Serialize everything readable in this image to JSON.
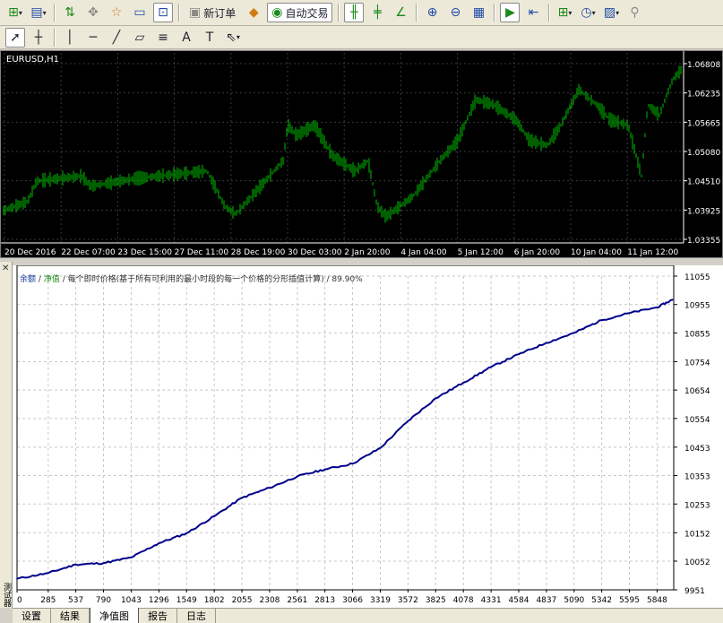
{
  "toolbar_main": {
    "new_order_label": "新订单",
    "auto_trade_label": "自动交易",
    "icons": [
      "new-chart-icon",
      "profiles-icon",
      "market-watch-icon",
      "navigator-icon",
      "data-window-icon",
      "terminal-icon",
      "tester-icon",
      "new-order-icon",
      "metaeditor-icon",
      "auto-trading-icon",
      "bar-chart-icon",
      "candlestick-icon",
      "line-chart-icon",
      "zoom-in-icon",
      "zoom-out-icon",
      "tile-windows-icon",
      "autoscroll-icon",
      "chart-shift-icon",
      "indicators-icon",
      "periods-icon",
      "templates-icon",
      "search-icon"
    ]
  },
  "toolbar_objects": {
    "icons": [
      "cursor-icon",
      "crosshair-icon",
      "vertical-line-icon",
      "horizontal-line-icon",
      "trendline-icon",
      "equidistant-channel-icon",
      "fibonacci-icon",
      "text-icon",
      "text-label-icon",
      "arrows-icon"
    ]
  },
  "price_chart": {
    "title": "EURUSD,H1",
    "price_labels": [
      "1.06808",
      "1.06235",
      "1.05665",
      "1.05080",
      "1.04510",
      "1.03925",
      "1.03355"
    ],
    "time_labels": [
      "20 Dec 2016",
      "22 Dec 07:00",
      "23 Dec 15:00",
      "27 Dec 11:00",
      "28 Dec 19:00",
      "30 Dec 03:00",
      "2 Jan 20:00",
      "4 Jan 04:00",
      "5 Jan 12:00",
      "6 Jan 20:00",
      "10 Jan 04:00",
      "11 Jan 12:00"
    ],
    "colors": {
      "background": "#000000",
      "bars": "#00c000",
      "grid": "#3a3a3a",
      "text": "#ffffff"
    }
  },
  "equity_legend": {
    "balance": "余额",
    "equity": "净值",
    "description": "每个即时价格(基于所有可利用的最小时段的每一个价格的分形插值计算)",
    "quality": "89.90%"
  },
  "chart_data": {
    "type": "line",
    "x": [
      0,
      285,
      537,
      790,
      1043,
      1296,
      1549,
      1802,
      2055,
      2308,
      2561,
      2813,
      3066,
      3319,
      3572,
      3825,
      4078,
      4331,
      4584,
      4837,
      5090,
      5342,
      5595,
      5848,
      5990
    ],
    "series": [
      {
        "name": "净值",
        "values": [
          9990,
          10010,
          10040,
          10045,
          10065,
          10115,
          10150,
          10210,
          10275,
          10310,
          10350,
          10375,
          10395,
          10450,
          10545,
          10625,
          10680,
          10735,
          10780,
          10820,
          10855,
          10900,
          10925,
          10945,
          10972
        ]
      }
    ],
    "xticks": [
      "0",
      "285",
      "537",
      "790",
      "1043",
      "1296",
      "1549",
      "1802",
      "2055",
      "2308",
      "2561",
      "2813",
      "3066",
      "3319",
      "3572",
      "3825",
      "4078",
      "4331",
      "4584",
      "4837",
      "5090",
      "5342",
      "5595",
      "5848"
    ],
    "yticks": [
      "11055",
      "10955",
      "10855",
      "10754",
      "10654",
      "10554",
      "10453",
      "10353",
      "10253",
      "10152",
      "10052",
      "9951"
    ],
    "ylim": [
      9951,
      11055
    ],
    "xlim": [
      0,
      6000
    ],
    "grid": true,
    "colors": {
      "line": "#00008b",
      "grid": "#c8c8c8"
    }
  },
  "side_label": "测试器",
  "tabs": [
    {
      "label": "设置",
      "active": false
    },
    {
      "label": "结果",
      "active": false
    },
    {
      "label": "净值图",
      "active": true
    },
    {
      "label": "报告",
      "active": false
    },
    {
      "label": "日志",
      "active": false
    }
  ]
}
